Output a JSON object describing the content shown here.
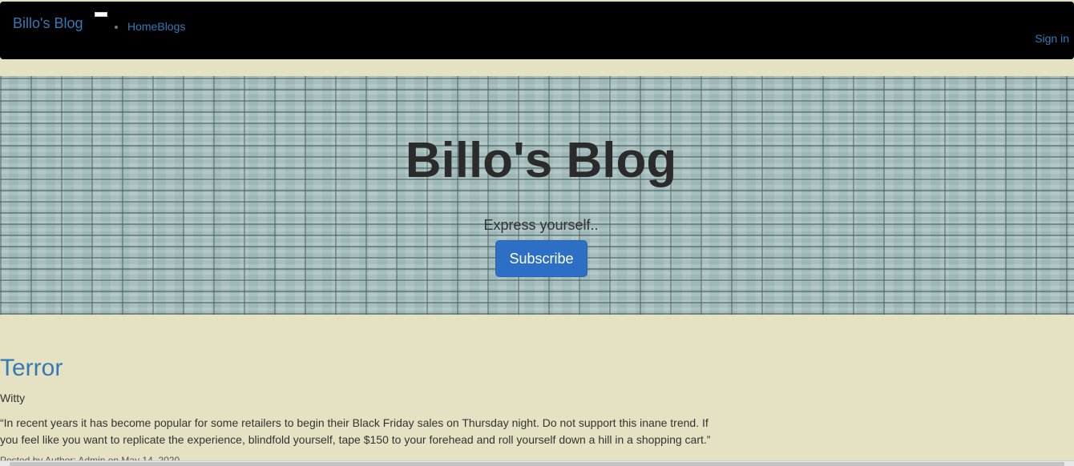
{
  "navbar": {
    "brand": "Billo's Blog",
    "toggle_icon": "menu-toggle-icon",
    "nav_home": "Home",
    "nav_blogs": "Blogs",
    "signin": "Sign in"
  },
  "hero": {
    "title": "Billo's Blog",
    "subtitle": "Express yourself..",
    "subscribe": "Subscribe"
  },
  "post": {
    "title": "Terror",
    "subtitle": "Witty",
    "body": "“In recent years it has become popular for some retailers to begin their Black Friday sales on Thursday night. Do not support this inane trend. If you feel like you want to replicate the experience, blindfold yourself, tape $150 to your forehead and roll yourself down a hill in a shopping cart.”",
    "meta": "Posted by Author: Admin on May 14, 2020"
  },
  "colors": {
    "background": "#e4e2c2",
    "navbar": "#000000",
    "link": "#337ab7",
    "button": "#2c6fc5"
  }
}
